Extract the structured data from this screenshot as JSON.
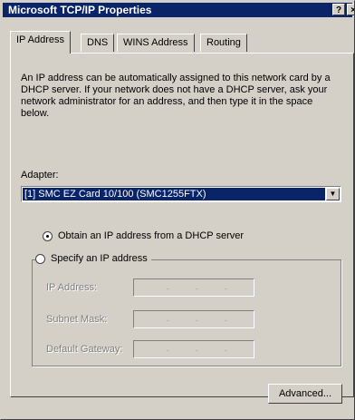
{
  "window": {
    "title": "Microsoft TCP/IP Properties",
    "help_glyph": "?",
    "close_glyph": "×"
  },
  "tabs": [
    {
      "label": "IP Address",
      "active": true
    },
    {
      "label": "DNS",
      "active": false
    },
    {
      "label": "WINS Address",
      "active": false
    },
    {
      "label": "Routing",
      "active": false
    }
  ],
  "ip_tab": {
    "description": "An IP address can be automatically assigned to this network card by a DHCP server.  If your network does not have a DHCP server, ask your network administrator for an address, and then type it in the space below.",
    "adapter_label": "Adapter:",
    "adapter_value": "[1] SMC EZ Card 10/100 (SMC1255FTX)",
    "radio_dhcp": {
      "label": "Obtain an IP address from a DHCP server",
      "selected": true
    },
    "radio_specify": {
      "label": "Specify an IP address",
      "selected": false
    },
    "fields": [
      {
        "label": "IP Address:",
        "value": ""
      },
      {
        "label": "Subnet Mask:",
        "value": ""
      },
      {
        "label": "Default Gateway:",
        "value": ""
      }
    ],
    "advanced_button": "Advanced..."
  },
  "colors": {
    "titlebar": "#0a246a",
    "face": "#d4d0c8",
    "selection": "#0a246a",
    "disabled_text": "#808080"
  }
}
